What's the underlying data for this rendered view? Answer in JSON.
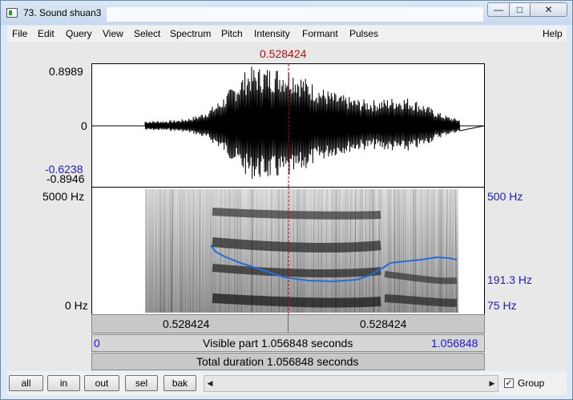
{
  "window": {
    "title": "73. Sound shuan3",
    "minimize": "—",
    "maximize": "□",
    "close": "✕"
  },
  "menu": [
    "File",
    "Edit",
    "Query",
    "View",
    "Select",
    "Spectrum",
    "Pitch",
    "Intensity",
    "Formant",
    "Pulses"
  ],
  "help": "Help",
  "cursor_time": "0.528424",
  "waveform": {
    "max": "0.8989",
    "zero": "0",
    "cursor_top": "-0.6238",
    "min": "-0.8946"
  },
  "spectrogram": {
    "top_hz": "5000 Hz",
    "bottom_hz": "0 Hz",
    "pitch_top": "500 Hz",
    "pitch_cursor": "191.3 Hz",
    "pitch_bottom": "75 Hz"
  },
  "time_bar": {
    "left": "0.528424",
    "right": "0.528424"
  },
  "visible_bar": {
    "start": "0",
    "label": "Visible part 1.056848 seconds",
    "end": "1.056848"
  },
  "total_bar": {
    "label": "Total duration 1.056848 seconds"
  },
  "buttons": {
    "all": "all",
    "in": "in",
    "out": "out",
    "sel": "sel",
    "bak": "bak"
  },
  "scroll": {
    "left": "◀",
    "right": "▶"
  },
  "group": {
    "label": "Group",
    "checked": "✓"
  },
  "colors": {
    "cursor": "#d00000",
    "pitch": "#1f6fe0",
    "axis_blue": "#1a1ad0"
  }
}
